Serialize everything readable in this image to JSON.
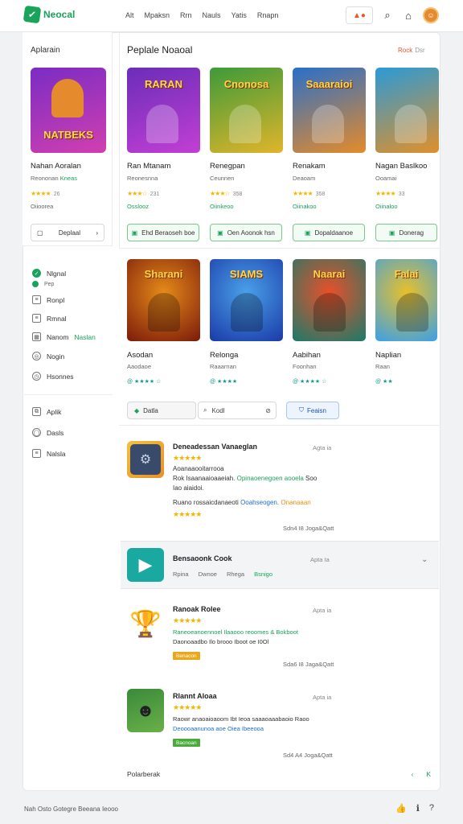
{
  "header": {
    "logo_text": "Neocal",
    "nav": [
      "Alt",
      "Mpaksn",
      "Rrn",
      "Nauls",
      "Yatis",
      "Rnapn"
    ],
    "notif_label": "A",
    "icons": [
      "search-icon",
      "cart-icon",
      "avatar"
    ]
  },
  "sidebar": {
    "title": "Aplarain",
    "featured": {
      "art_text": "NATBEKS",
      "name": "Nahan Aoralan",
      "sub_a": "Reononan",
      "sub_b": "Kneas",
      "stars": "★★★★",
      "count": "26",
      "meta": "Oiioorea",
      "button": "Deplaal"
    },
    "menu_heading": "Nlgnal",
    "menu_sub": "Pep",
    "menu": [
      {
        "label": "Ronpl",
        "icon": "list-icon"
      },
      {
        "label": "Rmnal",
        "icon": "list-icon"
      },
      {
        "label": "Nanom",
        "extra": "Naslan",
        "icon": "grid-icon"
      },
      {
        "label": "Nogin",
        "icon": "globe-icon"
      },
      {
        "label": "Hsonnes",
        "icon": "clock-icon"
      }
    ],
    "menu2": [
      {
        "label": "Aplik",
        "icon": "link-icon"
      },
      {
        "label": "Dasls",
        "icon": "circle-icon"
      },
      {
        "label": "Nalsla",
        "icon": "list-icon"
      }
    ]
  },
  "section": {
    "title": "Peplale Noaoal",
    "link": "Rock",
    "link_sub": "Dsr"
  },
  "row1": [
    {
      "art": "RARAN",
      "name": "Ran Mtanam",
      "sub": "Reonesnna",
      "stars": "★★★☆",
      "count": "231",
      "meta": "Osslooz",
      "button": "Ehd Beraoseh boe",
      "colors": [
        "#6a2db8",
        "#c23fd4"
      ]
    },
    {
      "art": "Cnonosa",
      "name": "Renegpan",
      "sub": "Ceunnen",
      "stars": "★★★☆",
      "count": "358",
      "meta": "Oiinkeoo",
      "button": "Oen Aoonok hsn",
      "colors": [
        "#3d9a3a",
        "#e1b52a"
      ]
    },
    {
      "art": "Saaaraioi",
      "name": "Renakam",
      "sub": "Deaoam",
      "stars": "★★★★",
      "count": "358",
      "meta": "Oiinakoo",
      "button": "Dopaldaanoe",
      "colors": [
        "#2a6fc9",
        "#e58b2a"
      ]
    },
    {
      "art": "",
      "name": "Nagan Baslkoo",
      "sub": "Ooamai",
      "stars": "★★★★",
      "count": "33",
      "meta": "Oiinaloo",
      "button": "Donerag",
      "colors": [
        "#2a9ad8",
        "#e0902a"
      ]
    }
  ],
  "row2": [
    {
      "art": "Sharani",
      "name": "Asodan",
      "sub": "Aaodaoe",
      "rating": "@ ★★★★ ☆",
      "colors": [
        "#7a1a0a",
        "#e58a1a"
      ]
    },
    {
      "art": "SIAMS",
      "name": "Relonga",
      "sub": "Raaarnan",
      "rating": "@ ★★★★",
      "colors": [
        "#1a3aa8",
        "#4aa0e8"
      ]
    },
    {
      "art": "Naarai",
      "name": "Aabihan",
      "sub": "Foonhan",
      "rating": "@ ★★★★ ☆",
      "colors": [
        "#1a7a6a",
        "#e8502a"
      ]
    },
    {
      "art": "Falai",
      "name": "Naplian",
      "sub": "Raan",
      "rating": "@ ★★",
      "colors": [
        "#3aa0e8",
        "#e8c02a"
      ]
    }
  ],
  "filters": {
    "btn_label": "Datla",
    "search_placeholder": "Kodl",
    "blue_btn": "Feaisn"
  },
  "reviews": [
    {
      "title": "Deneadessan Vanaeglan",
      "date": "Agta ia",
      "stars": "★★★★★",
      "line1": "Aoanaaooitarrooa",
      "line2a": "Rok Isaanaaioaaeiah.",
      "line2g": "Opinaoenegoen aooela",
      "line2b": " Soo",
      "line3": "Iao aiaidoi.",
      "line4a": "Ruano rossaicdanaeoti ",
      "line4b": "Ooahseogen.",
      "line4o": "Onanaaan",
      "stars2": "★★★★★",
      "foot": "Sdn4 I8 Joga&Qatt"
    },
    {
      "title": "Bensaoonk Cook",
      "date": "Apta Ia",
      "meta": [
        "Rpina",
        "Dwnoe",
        "Rhega",
        "Bsnigo"
      ]
    },
    {
      "title": "Ranoak Rolee",
      "date": "Apta ia",
      "stars": "★★★★★",
      "line1": "Raneoeanoennoel Ilaaooo reoomes & Bokboot",
      "line2": "Daonoaadbo Ilo brooo Iboot oe I0Ol",
      "tag": "Benacon",
      "foot": "Sda6 I8 Jaga&Qatt"
    },
    {
      "title": "Rlannt Aloaa",
      "date": "Apta ia",
      "stars": "★★★★★",
      "line1": "Raowr anaoaioaoom Ibt Ieoa saaaoaaabaoio Raoo",
      "line2": "Deoooaanunoa aoe Oiea Ibeeooa",
      "tag": "Bacnoan",
      "foot": "Sd4 A4 Joga&Qatt"
    }
  ],
  "pager": {
    "label": "Polarberak",
    "ctrl": [
      "‹",
      "K"
    ]
  },
  "footer": {
    "text": "Nah Osto Gotegre Beeana Ieooo"
  }
}
